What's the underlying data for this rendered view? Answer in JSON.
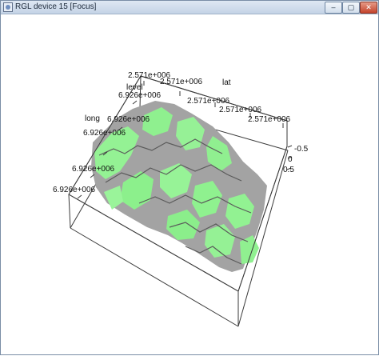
{
  "window": {
    "title": "RGL device 15 [Focus]",
    "controls": {
      "minimize": "–",
      "maximize": "▢",
      "close": "✕"
    }
  },
  "plot": {
    "axis_titles": {
      "level": "level",
      "lat": "lat",
      "long": "long"
    },
    "lat_ticks": [
      "2.571e+006",
      "2.571e+006",
      "2.571e+006",
      "2.571e+006",
      "2.571e+006"
    ],
    "long_ticks": [
      "6.926e+006",
      "6.926e+006",
      "6.926e+006",
      "6.926e+006",
      "6.926e+006"
    ],
    "level_ticks": [
      "-0.5",
      "0",
      "0.5"
    ],
    "colors": {
      "surface_green": "#8ef08e",
      "surface_gray": "#9a9a9a",
      "box": "#3a3a3a"
    }
  }
}
